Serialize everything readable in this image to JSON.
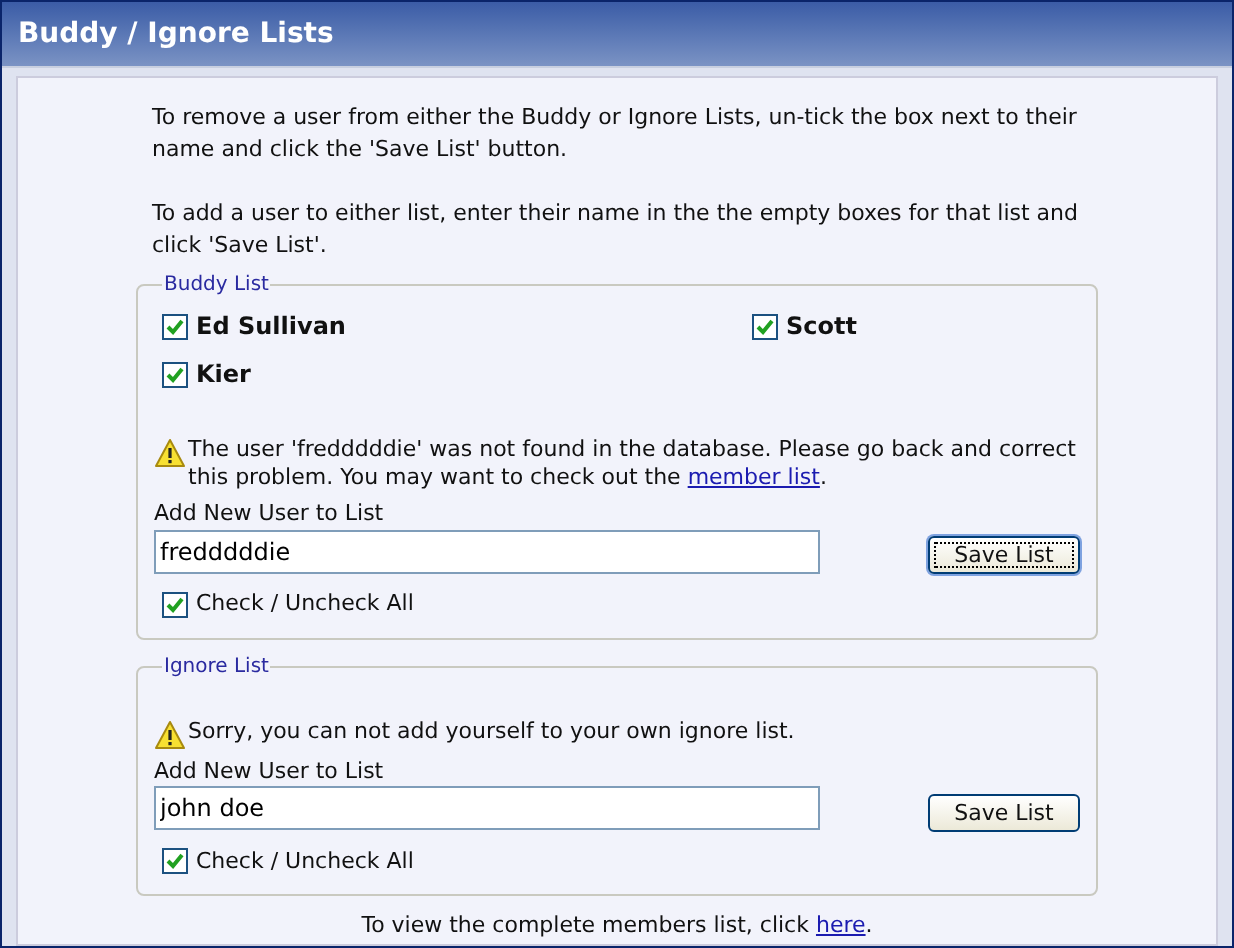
{
  "window": {
    "title": "Buddy / Ignore Lists"
  },
  "intro": [
    "To remove a user from either the Buddy or Ignore Lists, un-tick the box next to their name and click the 'Save List' button.",
    "To add a user to either list, enter their name in the the empty boxes for that list and click 'Save List'."
  ],
  "lists": [
    {
      "legend": "Buddy List",
      "users": [
        {
          "name": "Ed Sullivan",
          "checked": true
        },
        {
          "name": "Scott",
          "checked": true
        },
        {
          "name": "Kier",
          "checked": true
        }
      ],
      "warning": {
        "text": "The user 'fredddddie' was not found in the database. Please go back and correct this problem. You may want to check out the ",
        "link": "member list",
        "after": "."
      },
      "add_label": "Add New User to List",
      "value": "fredddddie",
      "button": "Save List",
      "button_focused": true,
      "check_all": {
        "label": "Check / Uncheck All",
        "checked": true
      }
    },
    {
      "legend": "Ignore List",
      "warning": {
        "text": "Sorry, you can not add yourself to your own ignore list."
      },
      "add_label": "Add New User to List",
      "value": "john doe",
      "button": "Save List",
      "button_focused": false,
      "check_all": {
        "label": "Check / Uncheck All",
        "checked": true
      }
    }
  ],
  "footer": {
    "text": "To view the complete members list, click ",
    "link": "here",
    "after": "."
  }
}
